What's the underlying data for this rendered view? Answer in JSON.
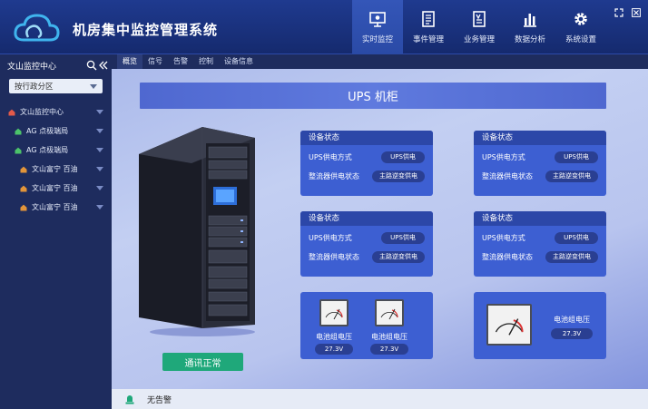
{
  "app": {
    "title": "机房集中监控管理系统"
  },
  "nav": [
    {
      "label": "实时监控",
      "icon": "monitor-icon",
      "active": true
    },
    {
      "label": "事件管理",
      "icon": "document-icon",
      "active": false
    },
    {
      "label": "业务管理",
      "icon": "business-icon",
      "active": false
    },
    {
      "label": "数据分析",
      "icon": "bar-chart-icon",
      "active": false
    },
    {
      "label": "系统设置",
      "icon": "gear-icon",
      "active": false
    }
  ],
  "sidebar": {
    "title": "文山监控中心",
    "region_select": "按行政分区",
    "tree": [
      {
        "label": "文山监控中心",
        "level": 0,
        "color": "#e25a4a"
      },
      {
        "label": "AG 点极端局",
        "level": 1,
        "color": "#4cc36a"
      },
      {
        "label": "AG 点极端局",
        "level": 1,
        "color": "#4cc36a"
      },
      {
        "label": "文山富宁 百油",
        "level": 2,
        "color": "#e2953a"
      },
      {
        "label": "文山富宁 百油",
        "level": 2,
        "color": "#e2953a"
      },
      {
        "label": "文山富宁 百油",
        "level": 2,
        "color": "#e2953a"
      }
    ]
  },
  "tabs": [
    "概览",
    "信号",
    "告警",
    "控制",
    "设备信息"
  ],
  "main": {
    "title": "UPS 机柜",
    "comm_status": "通讯正常",
    "cards": [
      {
        "header": "设备状态",
        "rows": [
          {
            "label": "UPS供电方式",
            "value": "UPS供电"
          },
          {
            "label": "整流器供电状态",
            "value": "主路逆变供电"
          }
        ]
      },
      {
        "header": "设备状态",
        "rows": [
          {
            "label": "UPS供电方式",
            "value": "UPS供电"
          },
          {
            "label": "整流器供电状态",
            "value": "主路逆变供电"
          }
        ]
      },
      {
        "header": "设备状态",
        "rows": [
          {
            "label": "UPS供电方式",
            "value": "UPS供电"
          },
          {
            "label": "整流器供电状态",
            "value": "主路逆变供电"
          }
        ]
      },
      {
        "header": "设备状态",
        "rows": [
          {
            "label": "UPS供电方式",
            "value": "UPS供电"
          },
          {
            "label": "整流器供电状态",
            "value": "主路逆变供电"
          }
        ]
      }
    ],
    "meters_left": [
      {
        "label": "电池组电压",
        "value": "27.3V"
      },
      {
        "label": "电池组电压",
        "value": "27.3V"
      }
    ],
    "meter_right": {
      "label": "电池组电压",
      "value": "27.3V"
    }
  },
  "footer": {
    "status": "无告警"
  },
  "colors": {
    "accent": "#2a4aa6",
    "ok": "#1fa87a",
    "card": "#3d5fd2"
  }
}
